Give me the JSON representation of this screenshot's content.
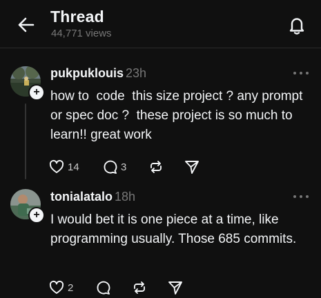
{
  "header": {
    "title": "Thread",
    "views": "44,771 views",
    "back_icon": "arrow-left-icon",
    "notification_icon": "bell-icon"
  },
  "posts": [
    {
      "username": "pukpuklouis",
      "time": "23h",
      "text": "how to  code  this size project ? any prompt or spec doc ?  these project is so much to learn!! great work",
      "likes": "14",
      "replies": "3",
      "reposts": "",
      "avatar_icon": "avatar-photo-icon"
    },
    {
      "username": "tonialatalo",
      "time": "18h",
      "text": "I would bet it is one piece at a time, like programming usually. Those 685 commits.",
      "likes": "2",
      "replies": "",
      "reposts": "",
      "avatar_icon": "avatar-photo-icon"
    }
  ],
  "colors": {
    "background": "#101010",
    "text_primary": "#f3f5f7",
    "text_secondary": "#777777"
  }
}
